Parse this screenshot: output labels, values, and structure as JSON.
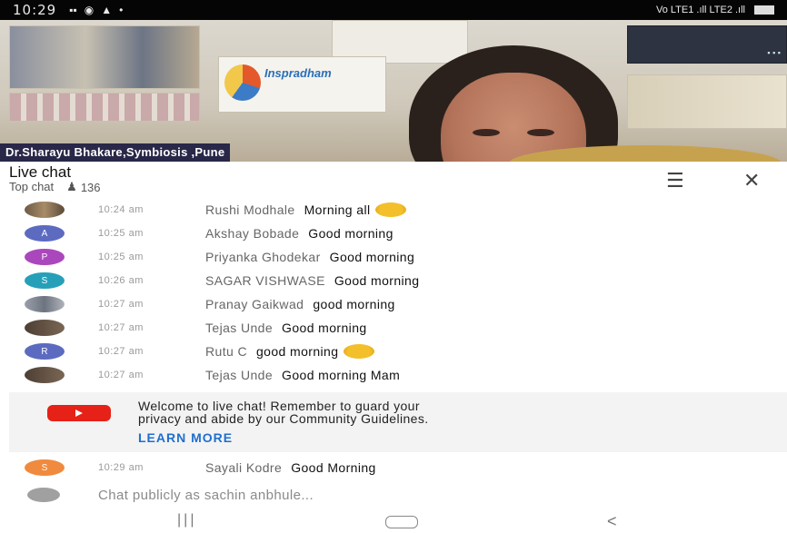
{
  "status_bar": {
    "time": "10:29",
    "network": "Vo LTE1 .ıll LTE2 .ıll"
  },
  "video": {
    "presenter_caption": "Dr.Sharayu Bhakare,Symbiosis ,Pune",
    "poster_brand": "Inspradham"
  },
  "chat_header": {
    "title": "Live chat",
    "mode": "Top chat",
    "viewer_count": "136",
    "icons": [
      "filter-icon",
      "close-icon"
    ]
  },
  "messages": [
    {
      "time": "10:24 am",
      "author": "Rushi Modhale",
      "text": "Morning all",
      "emoji": true,
      "avatar": "photo"
    },
    {
      "time": "10:25 am",
      "author": "Akshay Bobade",
      "text": "Good morning",
      "avatar_letter": "A",
      "avatar_color": "#5c6bc0"
    },
    {
      "time": "10:25 am",
      "author": "Priyanka Ghodekar",
      "text": "Good morning",
      "avatar_letter": "P",
      "avatar_color": "#ab47bc"
    },
    {
      "time": "10:26 am",
      "author": "SAGAR VISHWASE",
      "text": "Good morning",
      "avatar_letter": "S",
      "avatar_color": "#26a0b8"
    },
    {
      "time": "10:27 am",
      "author": "Pranay Gaikwad",
      "text": "good morning",
      "avatar": "photo3"
    },
    {
      "time": "10:27 am",
      "author": "Tejas Unde",
      "text": "Good morning",
      "avatar": "photo2"
    },
    {
      "time": "10:27 am",
      "author": "Rutu C",
      "text": "good morning",
      "emoji": true,
      "avatar_letter": "R",
      "avatar_color": "#5c6bc0"
    },
    {
      "time": "10:27 am",
      "author": "Tejas Unde",
      "text": "Good morning Mam",
      "avatar": "photo2"
    }
  ],
  "welcome": {
    "line1": "Welcome to live chat! Remember to guard your",
    "line2": "privacy and abide by our Community Guidelines.",
    "learn_more": "LEARN MORE"
  },
  "last_message": {
    "time": "10:29 am",
    "author": "Sayali Kodre",
    "text": "Good Morning",
    "avatar_letter": "S",
    "avatar_color": "#f08a3e"
  },
  "chat_input": {
    "placeholder": "Chat publicly as sachin anbhule..."
  },
  "nav_bar": {
    "recent": "|||",
    "back": "<"
  }
}
